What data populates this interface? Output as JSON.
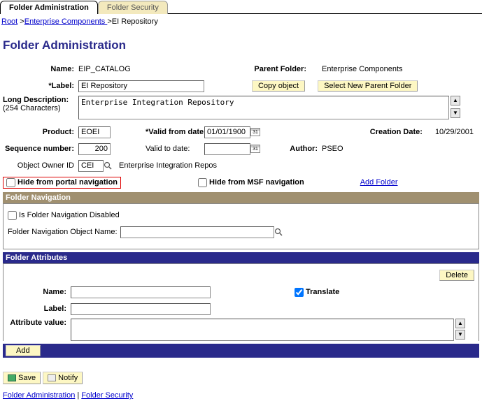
{
  "tabs": {
    "admin": "Folder Administration",
    "security": "Folder Security"
  },
  "breadcrumb": {
    "root": "Root",
    "sep": " >",
    "comp": "Enterprise Components ",
    "rep": "EI Repository"
  },
  "title": "Folder Administration",
  "labels": {
    "name": "Name:",
    "label": "*Label:",
    "longdesc": "Long Description:",
    "longdesc2": "(254 Characters)",
    "product": "Product:",
    "validfrom": "*Valid from date:",
    "creation": "Creation Date:",
    "seq": "Sequence number:",
    "validto": "Valid to date:",
    "author": "Author:",
    "owner": "Object Owner ID",
    "hideportal": "Hide from portal navigation",
    "hidemsf": "Hide from MSF navigation",
    "addfolder": "Add Folder",
    "navdisabled": "Is Folder Navigation Disabled",
    "navobj": "Folder Navigation Object Name:",
    "attr_name": "Name:",
    "attr_label": "Label:",
    "attr_val": "Attribute value:",
    "translate": "Translate",
    "parent": "Parent Folder:"
  },
  "values": {
    "name": "EIP_CATALOG",
    "label": "EI Repository",
    "longdesc": "Enterprise Integration Repository",
    "product": "EOEI",
    "validfrom": "01/01/1900",
    "creation": "10/29/2001",
    "seq": "200",
    "validto": "",
    "author": "PSEO",
    "owner": "CEI",
    "owner_desc": "Enterprise Integration Repos",
    "navobj": "",
    "attr_name": "",
    "attr_label": "",
    "attr_val": "",
    "parent": "Enterprise Components",
    "translate_checked": "✓"
  },
  "buttons": {
    "copy": "Copy object",
    "selectparent": "Select New Parent Folder",
    "add": "Add",
    "delete": "Delete",
    "save": "Save",
    "notify": "Notify"
  },
  "sections": {
    "nav": "Folder Navigation",
    "attrs": "Folder Attributes"
  },
  "footer": {
    "admin": "Folder Administration",
    "sep": " | ",
    "security": "Folder Security"
  }
}
